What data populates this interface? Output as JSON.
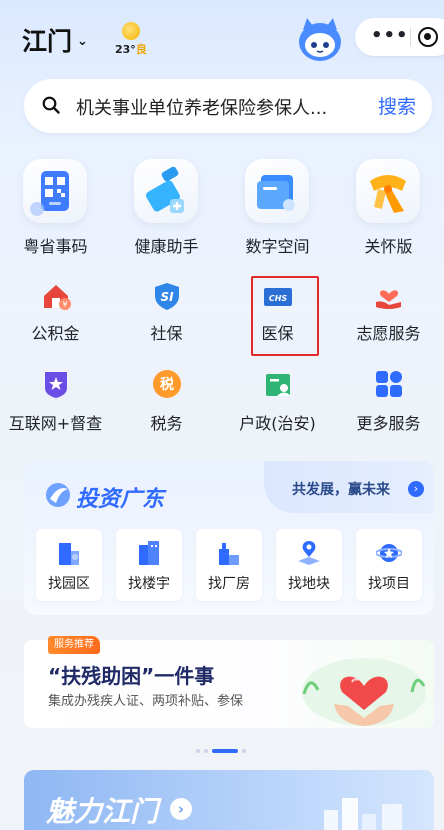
{
  "header": {
    "city": "江门",
    "weather": {
      "temp": "23°",
      "quality": "良"
    }
  },
  "search": {
    "placeholder": "机关事业单位养老保险参保人...",
    "button": "搜索"
  },
  "services_row1": [
    {
      "label": "粤省事码",
      "icon": "qr-code-icon"
    },
    {
      "label": "健康助手",
      "icon": "health-assistant-icon"
    },
    {
      "label": "数字空间",
      "icon": "digital-space-icon"
    },
    {
      "label": "关怀版",
      "icon": "care-scarf-icon"
    }
  ],
  "services_row2": [
    {
      "label": "公积金",
      "icon": "housing-fund-icon"
    },
    {
      "label": "社保",
      "icon": "social-security-icon"
    },
    {
      "label": "医保",
      "icon": "medical-insurance-icon",
      "badge": "CHS"
    },
    {
      "label": "志愿服务",
      "icon": "volunteer-icon"
    }
  ],
  "services_row3": [
    {
      "label": "互联网+督查",
      "icon": "supervision-icon"
    },
    {
      "label": "税务",
      "icon": "tax-icon",
      "badge": "税"
    },
    {
      "label": "户政(治安)",
      "icon": "household-registration-icon"
    },
    {
      "label": "更多服务",
      "icon": "more-services-icon"
    }
  ],
  "invest": {
    "title": "投资广东",
    "tagline": "共发展，赢未来",
    "items": [
      {
        "label": "找园区"
      },
      {
        "label": "找楼宇"
      },
      {
        "label": "找厂房"
      },
      {
        "label": "找地块"
      },
      {
        "label": "找项目"
      }
    ]
  },
  "service_banner": {
    "badge": "服务推荐",
    "title": "“扶残助困”一件事",
    "desc": "集成办残疾人证、两项补贴、参保"
  },
  "charm": {
    "title": "魅力江门"
  },
  "colors": {
    "accent": "#2f6bff",
    "highlight_box": "#e02a2a"
  }
}
